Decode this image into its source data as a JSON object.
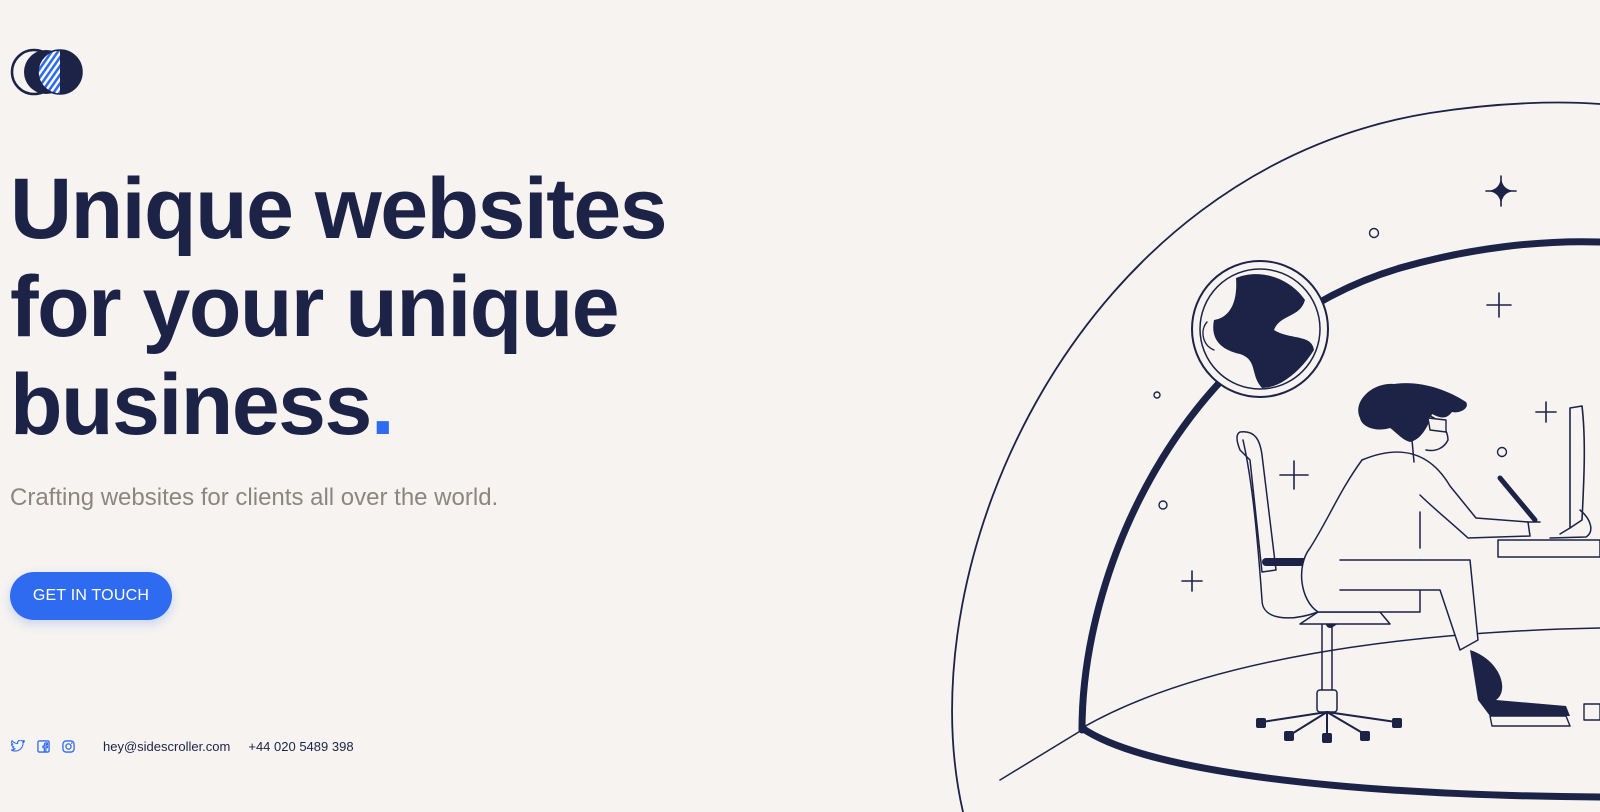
{
  "brand": {
    "logo_icon": "overlapping-circles-logo-icon",
    "accent_color": "#2f6bf0",
    "text_color": "#1c2347"
  },
  "hero": {
    "headline_lines": [
      "Unique websites",
      "for your unique",
      "business"
    ],
    "headline_dot": ".",
    "subtitle": "Crafting websites for clients all over the world.",
    "cta_label": "GET IN TOUCH"
  },
  "footer": {
    "social_icons": [
      "twitter-icon",
      "facebook-icon",
      "instagram-icon"
    ],
    "email": "hey@sidescroller.com",
    "phone": "+44 020 5489 398"
  },
  "illustration": {
    "subject": "person-at-desk-in-dome-illustration"
  }
}
